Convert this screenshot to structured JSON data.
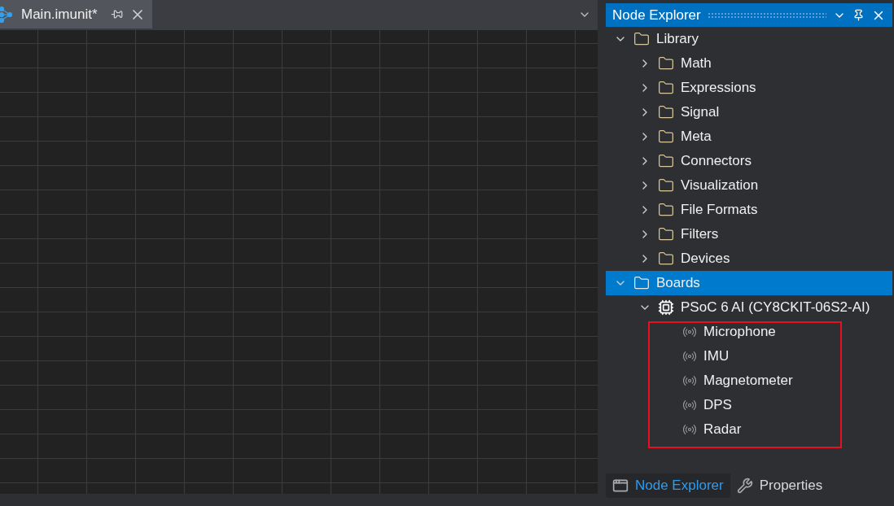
{
  "document_tab": {
    "title": "Main.imunit*",
    "selected": true
  },
  "node_explorer": {
    "title": "Node Explorer",
    "tree": [
      {
        "kind": "folder",
        "label": "Library",
        "expanded": true,
        "selected": false,
        "children": [
          {
            "kind": "folder",
            "label": "Math",
            "expanded": false,
            "selected": false
          },
          {
            "kind": "folder",
            "label": "Expressions",
            "expanded": false,
            "selected": false
          },
          {
            "kind": "folder",
            "label": "Signal",
            "expanded": false,
            "selected": false
          },
          {
            "kind": "folder",
            "label": "Meta",
            "expanded": false,
            "selected": false
          },
          {
            "kind": "folder",
            "label": "Connectors",
            "expanded": false,
            "selected": false
          },
          {
            "kind": "folder",
            "label": "Visualization",
            "expanded": false,
            "selected": false
          },
          {
            "kind": "folder",
            "label": "File Formats",
            "expanded": false,
            "selected": false
          },
          {
            "kind": "folder",
            "label": "Filters",
            "expanded": false,
            "selected": false
          },
          {
            "kind": "folder",
            "label": "Devices",
            "expanded": false,
            "selected": false
          }
        ]
      },
      {
        "kind": "folder",
        "label": "Boards",
        "expanded": true,
        "selected": true,
        "children": [
          {
            "kind": "board",
            "label": "PSoC 6 AI (CY8CKIT-06S2-AI)",
            "expanded": true,
            "selected": false,
            "children": [
              {
                "kind": "sensor",
                "label": "Microphone",
                "selected": false
              },
              {
                "kind": "sensor",
                "label": "IMU",
                "selected": false
              },
              {
                "kind": "sensor",
                "label": "Magnetometer",
                "selected": false
              },
              {
                "kind": "sensor",
                "label": "DPS",
                "selected": false
              },
              {
                "kind": "sensor",
                "label": "Radar",
                "selected": false
              }
            ]
          }
        ]
      }
    ]
  },
  "panel_tabs": [
    {
      "label": "Node Explorer",
      "selected": true,
      "kind": "window"
    },
    {
      "label": "Properties",
      "selected": false,
      "kind": "wrench"
    }
  ]
}
